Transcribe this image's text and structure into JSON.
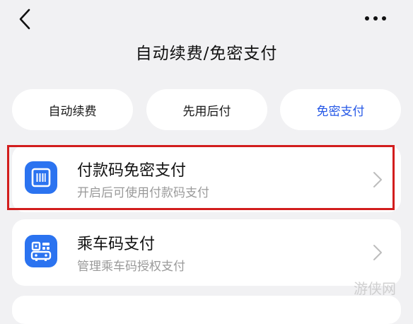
{
  "header": {
    "title": "自动续费/免密支付",
    "back_icon": "chevron-left-icon",
    "more_icon": "more-horizontal-icon"
  },
  "tabs": [
    {
      "label": "自动续费",
      "active": false
    },
    {
      "label": "先用后付",
      "active": false
    },
    {
      "label": "免密支付",
      "active": true
    }
  ],
  "items": [
    {
      "title": "付款码免密支付",
      "subtitle": "开启后可使用付款码支付",
      "icon": "payment-code-icon",
      "highlighted": true
    },
    {
      "title": "乘车码支付",
      "subtitle": "管理乘车码授权支付",
      "icon": "transit-qr-icon",
      "highlighted": false
    }
  ],
  "watermark": {
    "text": "游侠网"
  },
  "colors": {
    "accent": "#2457e6",
    "icon_bg": "#2b73f0",
    "highlight": "#d21d1d",
    "background": "#f1f1f3"
  }
}
